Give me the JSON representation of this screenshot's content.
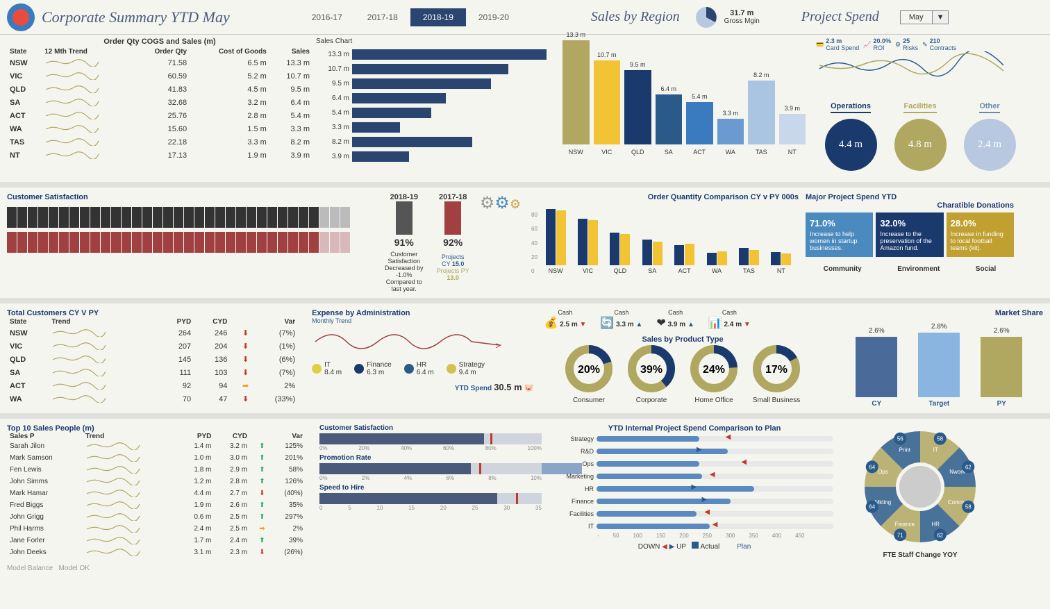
{
  "header": {
    "title": "Corporate Summary YTD May",
    "years": [
      "2016-17",
      "2017-18",
      "2018-19",
      "2019-20"
    ],
    "active_year": "2018-19",
    "sales_by_region": "Sales by Region",
    "gross_mgin_val": "31.7 m",
    "gross_mgin_lbl": "Gross Mgin",
    "project_spend": "Project Spend",
    "month": "May"
  },
  "kpi_small": {
    "card_spend": {
      "v": "2.3 m",
      "l": "Card Spend"
    },
    "roi": {
      "v": "20.0%",
      "l": "ROI"
    },
    "risks": {
      "v": "25",
      "l": "Risks"
    },
    "contracts": {
      "v": "210",
      "l": "Contracts"
    }
  },
  "sales_table": {
    "title": "Order Qty COGS and Sales (m)",
    "cols": [
      "State",
      "12 Mth Trend",
      "Order Qty",
      "Cost of Goods",
      "Sales",
      "Sales Chart"
    ],
    "rows": [
      {
        "state": "NSW",
        "oq": "71.58",
        "cogs": "6.5 m",
        "sales": "13.3 m"
      },
      {
        "state": "VIC",
        "oq": "60.59",
        "cogs": "5.2 m",
        "sales": "10.7 m"
      },
      {
        "state": "QLD",
        "oq": "41.83",
        "cogs": "4.5 m",
        "sales": "9.5 m"
      },
      {
        "state": "SA",
        "oq": "32.68",
        "cogs": "3.2 m",
        "sales": "6.4 m"
      },
      {
        "state": "ACT",
        "oq": "25.76",
        "cogs": "2.8 m",
        "sales": "5.4 m"
      },
      {
        "state": "WA",
        "oq": "15.60",
        "cogs": "1.5 m",
        "sales": "3.3 m"
      },
      {
        "state": "TAS",
        "oq": "22.18",
        "cogs": "3.3 m",
        "sales": "8.2 m"
      },
      {
        "state": "NT",
        "oq": "17.13",
        "cogs": "1.9 m",
        "sales": "3.9 m"
      }
    ]
  },
  "chart_data": [
    {
      "type": "bar",
      "orientation": "horizontal",
      "title": "Sales Chart",
      "categories": [
        "NSW",
        "VIC",
        "QLD",
        "SA",
        "ACT",
        "WA",
        "TAS",
        "NT"
      ],
      "values": [
        13.3,
        10.7,
        9.5,
        6.4,
        5.4,
        3.3,
        8.2,
        3.9
      ],
      "unit": "m"
    },
    {
      "type": "bar",
      "title": "Sales by Region",
      "categories": [
        "NSW",
        "VIC",
        "QLD",
        "SA",
        "ACT",
        "WA",
        "TAS",
        "NT"
      ],
      "values": [
        13.3,
        10.7,
        9.5,
        6.4,
        5.4,
        3.3,
        8.2,
        3.9
      ],
      "unit": "m",
      "colors": [
        "#b0a760",
        "#f2c335",
        "#1a3a6e",
        "#2a5a8a",
        "#3a7abf",
        "#6a9acf",
        "#aac5e2",
        "#c8d8ea"
      ]
    },
    {
      "type": "bar",
      "title": "Order Quantity Comparison CY v PY 000s",
      "categories": [
        "NSW",
        "VIC",
        "QLD",
        "SA",
        "ACT",
        "WA",
        "TAS",
        "NT"
      ],
      "series": [
        {
          "name": "CY",
          "values": [
            72,
            60,
            42,
            33,
            26,
            16,
            22,
            17
          ],
          "color": "#1a3a6e"
        },
        {
          "name": "PY",
          "values": [
            70,
            58,
            40,
            30,
            28,
            18,
            20,
            15
          ],
          "color": "#f2c335"
        }
      ],
      "ylim": [
        0,
        80
      ]
    },
    {
      "type": "pie",
      "title": "Sales by Product Type",
      "slices": [
        {
          "name": "Consumer",
          "value": 20
        },
        {
          "name": "Corporate",
          "value": 39
        },
        {
          "name": "Home Office",
          "value": 24
        },
        {
          "name": "Small Business",
          "value": 17
        }
      ]
    },
    {
      "type": "bar",
      "title": "Market Share",
      "categories": [
        "CY",
        "Target",
        "PY"
      ],
      "values": [
        2.6,
        2.8,
        2.6
      ],
      "unit": "%",
      "colors": [
        "#4a6a9a",
        "#8ab5e0",
        "#b0a760"
      ]
    }
  ],
  "proj_circles": [
    {
      "label": "Operations",
      "value": "4.4 m",
      "color": "#1a3a6e",
      "lc": "#1a3a6e"
    },
    {
      "label": "Facilities",
      "value": "4.8 m",
      "color": "#b0a760",
      "lc": "#b0a760"
    },
    {
      "label": "Other",
      "value": "2.4 m",
      "color": "#b8c8e0",
      "lc": "#6a8aaa"
    }
  ],
  "csat": {
    "title": "Customer Satisfaction",
    "cy_label": "2018-19",
    "py_label": "2017-18",
    "cy_pct": "91%",
    "py_pct": "92%",
    "note1": "Customer Satisfaction",
    "note2": "Decreased by -1.0%",
    "note3": "Compared to last year.",
    "proj_cy_l": "Projects CY",
    "proj_cy_v": "15.0",
    "proj_py_l": "Projects PY",
    "proj_py_v": "13.0"
  },
  "orderqty_title": "Order Quantity Comparison CY v PY 000s",
  "major_proj": {
    "title": "Major Project Spend YTD",
    "don_title": "Charatible Donations",
    "don_labels": [
      "Community",
      "Environment",
      "Social"
    ]
  },
  "donations": [
    {
      "pct": "71.0%",
      "txt": "Increase to help women in startup businesses.",
      "c": "#4a8abf"
    },
    {
      "pct": "32.0%",
      "txt": "Increase to the preservation of the Amazon fund.",
      "c": "#1a3a6e"
    },
    {
      "pct": "28.0%",
      "txt": "Increase in funding to local football teams (kit).",
      "c": "#c0a030"
    }
  ],
  "customers": {
    "title": "Total Customers CY V PY",
    "cols": [
      "State",
      "Trend",
      "PYD",
      "CYD",
      "Var"
    ],
    "rows": [
      {
        "s": "NSW",
        "p": "264",
        "c": "246",
        "v": "(7%)",
        "d": "dn"
      },
      {
        "s": "VIC",
        "p": "207",
        "c": "204",
        "v": "(1%)",
        "d": "dn"
      },
      {
        "s": "QLD",
        "p": "145",
        "c": "136",
        "v": "(6%)",
        "d": "dn"
      },
      {
        "s": "SA",
        "p": "111",
        "c": "103",
        "v": "(7%)",
        "d": "dn"
      },
      {
        "s": "ACT",
        "p": "92",
        "c": "94",
        "v": "2%",
        "d": "eq"
      },
      {
        "s": "WA",
        "p": "70",
        "c": "47",
        "v": "(33%)",
        "d": "dn"
      }
    ]
  },
  "expense": {
    "title": "Expense by Administration",
    "sub": "Monthly Trend",
    "ytd_l": "YTD Spend",
    "ytd_v": "30.5 m",
    "items": [
      {
        "n": "IT",
        "v": "8.4 m"
      },
      {
        "n": "Finance",
        "v": "6.3 m"
      },
      {
        "n": "HR",
        "v": "6.4 m"
      },
      {
        "n": "Strategy",
        "v": "9.4 m"
      }
    ]
  },
  "cash": [
    {
      "l": "Cash",
      "v": "2.5 m",
      "d": "▼",
      "c": "#c0392b"
    },
    {
      "l": "Cash",
      "v": "3.3 m",
      "d": "▲",
      "c": "#2a5a8a"
    },
    {
      "l": "Cash",
      "v": "3.9 m",
      "d": "▲",
      "c": "#2a5a8a"
    },
    {
      "l": "Cash",
      "v": "2.4 m",
      "d": "▼",
      "c": "#c0392b"
    }
  ],
  "product_type": {
    "title": "Sales by Product Type",
    "items": [
      {
        "n": "Consumer",
        "v": "20%"
      },
      {
        "n": "Corporate",
        "v": "39%"
      },
      {
        "n": "Home Office",
        "v": "24%"
      },
      {
        "n": "Small Business",
        "v": "17%"
      }
    ]
  },
  "market_share": {
    "title": "Market Share"
  },
  "salespeople": {
    "title": "Top 10 Sales People (m)",
    "cols": [
      "Sales P",
      "Trend",
      "PYD",
      "CYD",
      "Var"
    ],
    "rows": [
      {
        "n": "Sarah Jilon",
        "p": "1.4 m",
        "c": "3.2 m",
        "v": "125%",
        "d": "up"
      },
      {
        "n": "Mark Samson",
        "p": "1.0 m",
        "c": "3.0 m",
        "v": "201%",
        "d": "up"
      },
      {
        "n": "Fen Lewis",
        "p": "1.8 m",
        "c": "2.9 m",
        "v": "58%",
        "d": "up"
      },
      {
        "n": "John Simms",
        "p": "1.2 m",
        "c": "2.8 m",
        "v": "126%",
        "d": "up"
      },
      {
        "n": "Mark Hamar",
        "p": "4.4 m",
        "c": "2.7 m",
        "v": "(40%)",
        "d": "dn"
      },
      {
        "n": "Fred Biggs",
        "p": "1.9 m",
        "c": "2.6 m",
        "v": "35%",
        "d": "up"
      },
      {
        "n": "John Grigg",
        "p": "0.6 m",
        "c": "2.5 m",
        "v": "297%",
        "d": "up"
      },
      {
        "n": "Phil Harms",
        "p": "2.4 m",
        "c": "2.5 m",
        "v": "2%",
        "d": "eq"
      },
      {
        "n": "Jane Forler",
        "p": "1.7 m",
        "c": "2.4 m",
        "v": "39%",
        "d": "up"
      },
      {
        "n": "John Deeks",
        "p": "3.1 m",
        "c": "2.3 m",
        "v": "(26%)",
        "d": "dn"
      }
    ]
  },
  "bullets": [
    {
      "t": "Customer Satisfaction",
      "val": 74,
      "mark": 77,
      "axis": [
        "0%",
        "20%",
        "40%",
        "60%",
        "80%",
        "100%"
      ]
    },
    {
      "t": "Promotion Rate",
      "val": 6.8,
      "mark": 7.2,
      "max": 10,
      "axis": [
        "0%",
        "2%",
        "4%",
        "6%",
        "8%",
        "10%"
      ]
    },
    {
      "t": "Speed to Hire",
      "val": 28,
      "mark": 31,
      "max": 35,
      "axis": [
        "0",
        "5",
        "10",
        "15",
        "20",
        "25",
        "30",
        "35"
      ]
    }
  ],
  "projplan": {
    "title": "YTD Internal Project Spend Comparison to Plan",
    "rows": [
      {
        "l": "Strategy",
        "a": 195,
        "p": 245
      },
      {
        "l": "R&D",
        "a": 250,
        "p": 190
      },
      {
        "l": "Ops",
        "a": 195,
        "p": 275
      },
      {
        "l": "Marketing",
        "a": 200,
        "p": 215
      },
      {
        "l": "HR",
        "a": 300,
        "p": 180
      },
      {
        "l": "Finance",
        "a": 255,
        "p": 200
      },
      {
        "l": "Facilities",
        "a": 190,
        "p": 205
      },
      {
        "l": "IT",
        "a": 215,
        "p": 220
      }
    ],
    "axis": [
      "-",
      "50",
      "100",
      "150",
      "200",
      "250",
      "300",
      "350",
      "400",
      "450"
    ],
    "legend": {
      "down": "DOWN",
      "up": "UP",
      "actual": "Actual",
      "plan": "Plan"
    }
  },
  "gear": {
    "title": "FTE Staff Change YOY",
    "segs": [
      {
        "n": "IT",
        "v": 58
      },
      {
        "n": "Nwork",
        "v": 62
      },
      {
        "n": "Comms",
        "v": 58
      },
      {
        "n": "HR",
        "v": 62
      },
      {
        "n": "Finance",
        "v": 71
      },
      {
        "n": "Mkting",
        "v": 64
      },
      {
        "n": "Ops",
        "v": 64
      },
      {
        "n": "Print",
        "v": 56
      }
    ]
  },
  "footer": {
    "a": "Model Balance",
    "b": "Model OK"
  }
}
